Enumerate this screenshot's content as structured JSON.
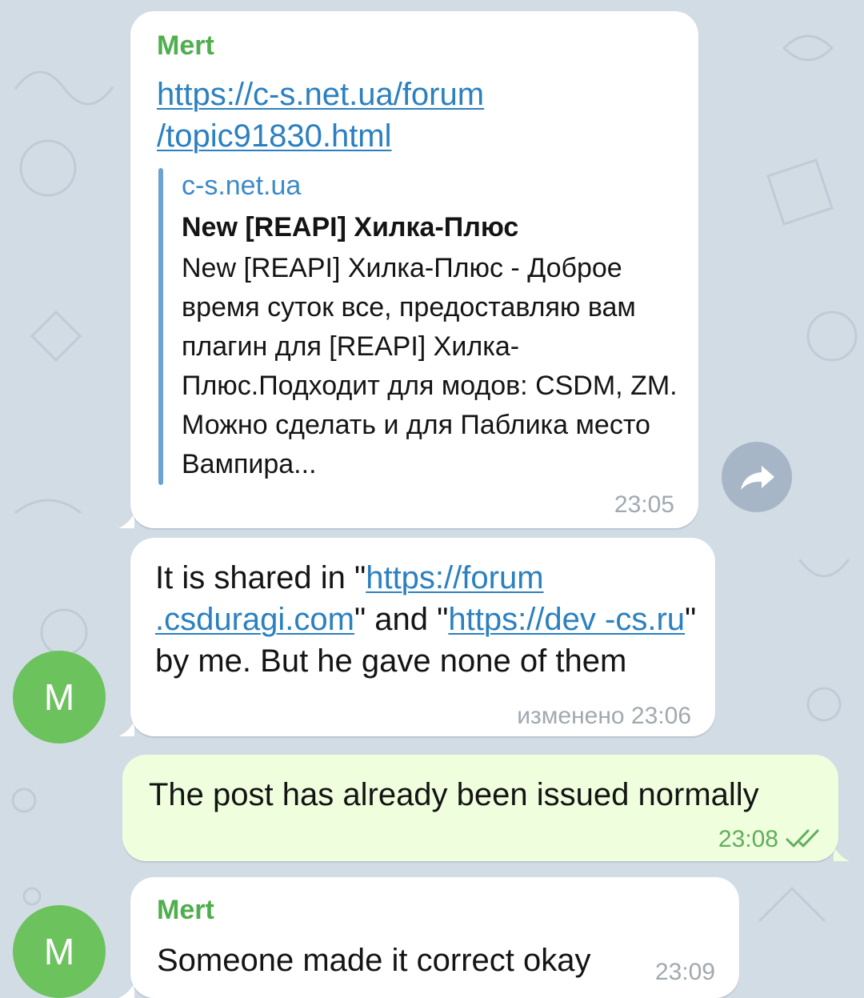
{
  "messages": [
    {
      "sender": "Mert",
      "link": {
        "line1": "https://c-s.net.ua/forum",
        "line2": "/topic91830.html"
      },
      "preview": {
        "site": "c-s.net.ua",
        "title": "New [REAPI] Хилка-Плюс",
        "description": "New [REAPI] Хилка-Плюс - Доброе время суток все, предоставляю вам плагин для [REAPI] Хилка-Плюс.Подходит для модов: CSDM, ZM. Можно сделать и для Паблика место Вампира..."
      },
      "time": "23:05",
      "share_icon": "share-arrow-icon"
    },
    {
      "avatar_letter": "M",
      "parts": {
        "p1": "It is shared in \"",
        "l1": "https://forum .csduragi.com",
        "p2": "\" and \"",
        "l2": "https://dev -cs.ru",
        "p3": "\" by me. But he gave none of them"
      },
      "time": "изменено 23:06"
    },
    {
      "direction": "outgoing",
      "text": "The post has already been issued normally",
      "time": "23:08",
      "status_icon": "double-check-icon"
    },
    {
      "avatar_letter": "M",
      "sender": "Mert",
      "text": "Someone made it correct okay",
      "time": "23:09"
    }
  ],
  "colors": {
    "background": "#d2dce5",
    "incoming_bubble": "#ffffff",
    "outgoing_bubble": "#effedd",
    "sender_name": "#4fae4e",
    "link": "#2b80c0",
    "avatar": "#6cc25d"
  }
}
